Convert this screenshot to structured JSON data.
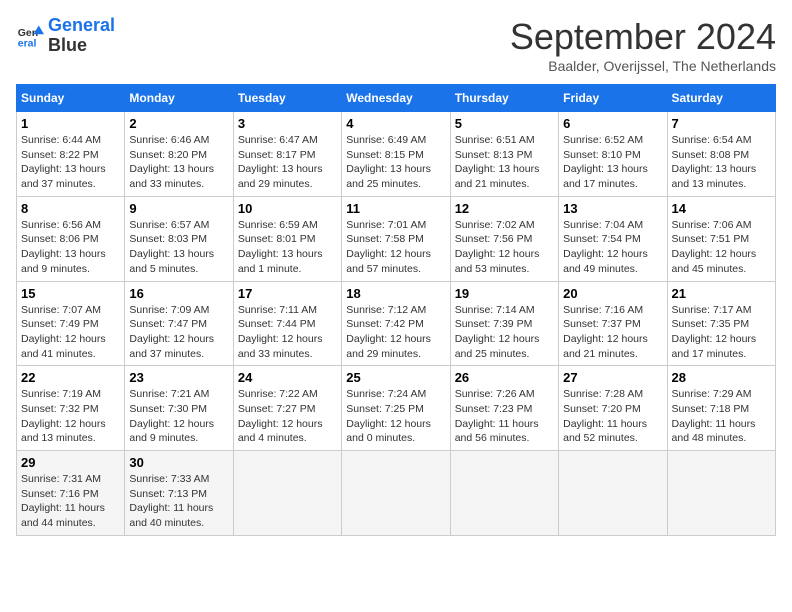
{
  "logo": {
    "line1": "General",
    "line2": "Blue"
  },
  "title": "September 2024",
  "subtitle": "Baalder, Overijssel, The Netherlands",
  "weekdays": [
    "Sunday",
    "Monday",
    "Tuesday",
    "Wednesday",
    "Thursday",
    "Friday",
    "Saturday"
  ],
  "weeks": [
    [
      {
        "day": "1",
        "info": "Sunrise: 6:44 AM\nSunset: 8:22 PM\nDaylight: 13 hours\nand 37 minutes."
      },
      {
        "day": "2",
        "info": "Sunrise: 6:46 AM\nSunset: 8:20 PM\nDaylight: 13 hours\nand 33 minutes."
      },
      {
        "day": "3",
        "info": "Sunrise: 6:47 AM\nSunset: 8:17 PM\nDaylight: 13 hours\nand 29 minutes."
      },
      {
        "day": "4",
        "info": "Sunrise: 6:49 AM\nSunset: 8:15 PM\nDaylight: 13 hours\nand 25 minutes."
      },
      {
        "day": "5",
        "info": "Sunrise: 6:51 AM\nSunset: 8:13 PM\nDaylight: 13 hours\nand 21 minutes."
      },
      {
        "day": "6",
        "info": "Sunrise: 6:52 AM\nSunset: 8:10 PM\nDaylight: 13 hours\nand 17 minutes."
      },
      {
        "day": "7",
        "info": "Sunrise: 6:54 AM\nSunset: 8:08 PM\nDaylight: 13 hours\nand 13 minutes."
      }
    ],
    [
      {
        "day": "8",
        "info": "Sunrise: 6:56 AM\nSunset: 8:06 PM\nDaylight: 13 hours\nand 9 minutes."
      },
      {
        "day": "9",
        "info": "Sunrise: 6:57 AM\nSunset: 8:03 PM\nDaylight: 13 hours\nand 5 minutes."
      },
      {
        "day": "10",
        "info": "Sunrise: 6:59 AM\nSunset: 8:01 PM\nDaylight: 13 hours\nand 1 minute."
      },
      {
        "day": "11",
        "info": "Sunrise: 7:01 AM\nSunset: 7:58 PM\nDaylight: 12 hours\nand 57 minutes."
      },
      {
        "day": "12",
        "info": "Sunrise: 7:02 AM\nSunset: 7:56 PM\nDaylight: 12 hours\nand 53 minutes."
      },
      {
        "day": "13",
        "info": "Sunrise: 7:04 AM\nSunset: 7:54 PM\nDaylight: 12 hours\nand 49 minutes."
      },
      {
        "day": "14",
        "info": "Sunrise: 7:06 AM\nSunset: 7:51 PM\nDaylight: 12 hours\nand 45 minutes."
      }
    ],
    [
      {
        "day": "15",
        "info": "Sunrise: 7:07 AM\nSunset: 7:49 PM\nDaylight: 12 hours\nand 41 minutes."
      },
      {
        "day": "16",
        "info": "Sunrise: 7:09 AM\nSunset: 7:47 PM\nDaylight: 12 hours\nand 37 minutes."
      },
      {
        "day": "17",
        "info": "Sunrise: 7:11 AM\nSunset: 7:44 PM\nDaylight: 12 hours\nand 33 minutes."
      },
      {
        "day": "18",
        "info": "Sunrise: 7:12 AM\nSunset: 7:42 PM\nDaylight: 12 hours\nand 29 minutes."
      },
      {
        "day": "19",
        "info": "Sunrise: 7:14 AM\nSunset: 7:39 PM\nDaylight: 12 hours\nand 25 minutes."
      },
      {
        "day": "20",
        "info": "Sunrise: 7:16 AM\nSunset: 7:37 PM\nDaylight: 12 hours\nand 21 minutes."
      },
      {
        "day": "21",
        "info": "Sunrise: 7:17 AM\nSunset: 7:35 PM\nDaylight: 12 hours\nand 17 minutes."
      }
    ],
    [
      {
        "day": "22",
        "info": "Sunrise: 7:19 AM\nSunset: 7:32 PM\nDaylight: 12 hours\nand 13 minutes."
      },
      {
        "day": "23",
        "info": "Sunrise: 7:21 AM\nSunset: 7:30 PM\nDaylight: 12 hours\nand 9 minutes."
      },
      {
        "day": "24",
        "info": "Sunrise: 7:22 AM\nSunset: 7:27 PM\nDaylight: 12 hours\nand 4 minutes."
      },
      {
        "day": "25",
        "info": "Sunrise: 7:24 AM\nSunset: 7:25 PM\nDaylight: 12 hours\nand 0 minutes."
      },
      {
        "day": "26",
        "info": "Sunrise: 7:26 AM\nSunset: 7:23 PM\nDaylight: 11 hours\nand 56 minutes."
      },
      {
        "day": "27",
        "info": "Sunrise: 7:28 AM\nSunset: 7:20 PM\nDaylight: 11 hours\nand 52 minutes."
      },
      {
        "day": "28",
        "info": "Sunrise: 7:29 AM\nSunset: 7:18 PM\nDaylight: 11 hours\nand 48 minutes."
      }
    ],
    [
      {
        "day": "29",
        "info": "Sunrise: 7:31 AM\nSunset: 7:16 PM\nDaylight: 11 hours\nand 44 minutes."
      },
      {
        "day": "30",
        "info": "Sunrise: 7:33 AM\nSunset: 7:13 PM\nDaylight: 11 hours\nand 40 minutes."
      },
      {
        "day": "",
        "info": ""
      },
      {
        "day": "",
        "info": ""
      },
      {
        "day": "",
        "info": ""
      },
      {
        "day": "",
        "info": ""
      },
      {
        "day": "",
        "info": ""
      }
    ]
  ]
}
